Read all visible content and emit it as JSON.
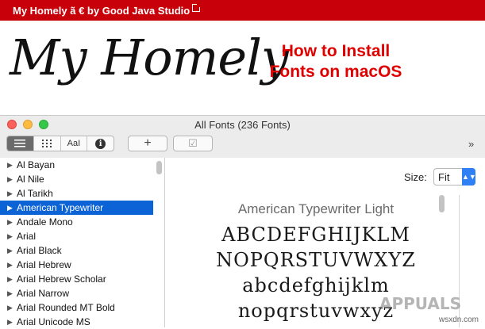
{
  "banner": {
    "text": "My Homely ã € by Good Java Studio"
  },
  "hero": {
    "logo": "My Homely",
    "headline_1": "How to Install",
    "headline_2": "Fonts on macOS"
  },
  "window": {
    "title": "All Fonts (236 Fonts)",
    "toolbar": {
      "add_label": "+",
      "validate_label": "☑",
      "overflow": "»"
    },
    "view_modes": [
      "list-view",
      "grid-view",
      "sample-view",
      "info-view"
    ],
    "view_mode_labels": {
      "sample": "AaI",
      "info": "i"
    },
    "fonts": [
      "Al Bayan",
      "Al Nile",
      "Al Tarikh",
      "American Typewriter",
      "Andale Mono",
      "Arial",
      "Arial Black",
      "Arial Hebrew",
      "Arial Hebrew Scholar",
      "Arial Narrow",
      "Arial Rounded MT Bold",
      "Arial Unicode MS"
    ],
    "selected_index": 3,
    "preview": {
      "size_label": "Size:",
      "size_value": "Fit",
      "font_name": "American Typewriter Light",
      "lines": [
        "ABCDEFGHIJKLM",
        "NOPQRSTUVWXYZ",
        "abcdefghijklm",
        "nopqrstuvwxyz"
      ]
    }
  },
  "watermark": {
    "brand": "APPUALS",
    "site": "wsxdn.com"
  },
  "colors": {
    "banner": "#c8000a",
    "headline": "#e00000",
    "selection": "#0b63d6",
    "size_arrow": "#2f7ff5"
  }
}
